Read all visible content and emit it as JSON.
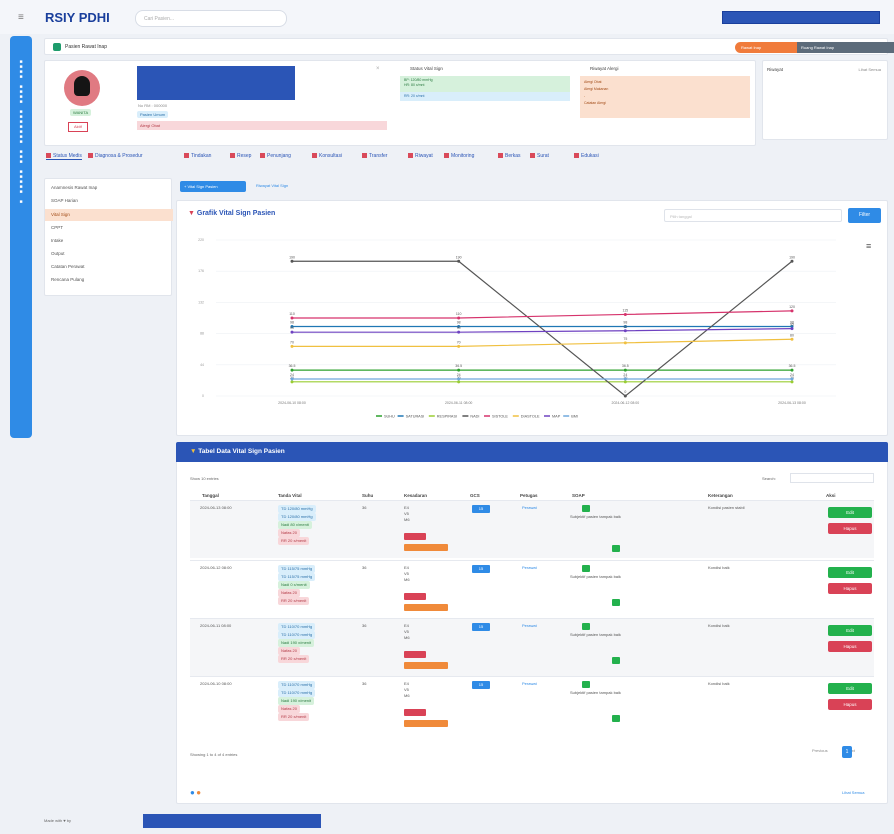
{
  "app": {
    "brand": "RSIY PDHI",
    "search_placeholder": "Cari Pasien..."
  },
  "header": {
    "title": "Pasien Rawat Inap",
    "status_pill": "Rawat Inap",
    "status_detail": "Ruang Rawat Inap"
  },
  "patient": {
    "gender_badge": "WANITA",
    "status_badge": "Aktif",
    "id_line": "No RM : 000000",
    "tag_blue": "Pasien Umum",
    "tag_red": "Alergi Obat"
  },
  "vital_card": {
    "title": "Status Vital Sign",
    "lines": [
      "BP: 120/80 mmHg",
      "HR: 80 x/mnt",
      "RR: 20 x/mnt"
    ]
  },
  "allergy_card": {
    "title": "Riwayat Alergi",
    "lines": [
      "Alergi Obat",
      "Alergi Makanan",
      "-",
      "Catatan Alergi"
    ]
  },
  "gap_card": {
    "title": "Riwayat",
    "link": "Lihat Semua"
  },
  "tabs": [
    "Status Medis",
    "Diagnosa & Prosedur",
    "Tindakan",
    "Resep",
    "Penunjang",
    "Konsultasi",
    "Transfer",
    "Riwayat",
    "Monitoring",
    "Berkas",
    "Surat",
    "Edukasi"
  ],
  "side_menu": [
    "Anamnesis Rawat Inap",
    "SOAP Harian",
    "Vital Sign",
    "CPPT",
    "Intake",
    "Output",
    "Catatan Perawat",
    "Rencana Pulang"
  ],
  "side_menu_active": 2,
  "buttons": {
    "add_vital": "+ Vital Sign Pasien",
    "export": "Riwayat Vital Sign",
    "filter": "Filter"
  },
  "chart": {
    "title": "Grafik Vital Sign Pasien",
    "filter_placeholder": "Pilih tanggal"
  },
  "chart_data": {
    "type": "line",
    "x": [
      "2024-06-10 08:00",
      "2024-06-11 08:00",
      "2024-06-12 08:00",
      "2024-06-13 08:00"
    ],
    "ylim": [
      0,
      220
    ],
    "series": [
      {
        "name": "SUHU",
        "color": "#2ca02c",
        "values": [
          36.5,
          36.5,
          36.5,
          36.5
        ]
      },
      {
        "name": "SATURASI",
        "color": "#1f77b4",
        "values": [
          98,
          98,
          98,
          98
        ]
      },
      {
        "name": "RESPIRASI",
        "color": "#9acd32",
        "values": [
          20,
          20,
          20,
          20
        ]
      },
      {
        "name": "NADI",
        "color": "#555555",
        "values": [
          190,
          190,
          0,
          190
        ]
      },
      {
        "name": "SISTOLE",
        "color": "#d6336c",
        "values": [
          110,
          110,
          115,
          120
        ]
      },
      {
        "name": "DIASTOLE",
        "color": "#f0c040",
        "values": [
          70,
          70,
          75,
          80
        ]
      },
      {
        "name": "MAP",
        "color": "#6f42c1",
        "values": [
          90,
          90,
          92,
          95
        ]
      },
      {
        "name": "BMI",
        "color": "#6fa8dc",
        "values": [
          24,
          24,
          24,
          24
        ]
      }
    ]
  },
  "table": {
    "title": "Tabel Data Vital Sign Pasien",
    "show_label": "Show 10 entries",
    "search_label": "Search:",
    "headers": [
      "Tanggal",
      "Tanda Vital",
      "Suhu",
      "Kesadaran",
      "GCS",
      "Petugas",
      "SOAP",
      "Keterangan",
      "Aksi"
    ],
    "rows": [
      {
        "date": "2024-06-13 08:00",
        "vital": [
          "TD 120/80 mmHg",
          "TD 120/80 mmHg",
          "Nadi 80 x/menit",
          "Nafas 20",
          "RR 20 x/menit"
        ],
        "suhu": "36",
        "kes": [
          "E4",
          "V5",
          "M6"
        ],
        "gcs": "15",
        "petugas": "Perawat",
        "soap": "Subjektif pasien tampak baik",
        "ket": "Kondisi pasien stabil"
      },
      {
        "date": "2024-06-12 08:00",
        "vital": [
          "TD 115/75 mmHg",
          "TD 115/75 mmHg",
          "Nadi 0 x/menit",
          "Nafas 20",
          "RR 20 x/menit"
        ],
        "suhu": "36",
        "kes": [
          "E4",
          "V5",
          "M6"
        ],
        "gcs": "15",
        "petugas": "Perawat",
        "soap": "Subjektif pasien tampak baik",
        "ket": "Kondisi baik"
      },
      {
        "date": "2024-06-11 08:00",
        "vital": [
          "TD 110/70 mmHg",
          "TD 110/70 mmHg",
          "Nadi 190 x/menit",
          "Nafas 20",
          "RR 20 x/menit"
        ],
        "suhu": "36",
        "kes": [
          "E4",
          "V5",
          "M6"
        ],
        "gcs": "15",
        "petugas": "Perawat",
        "soap": "Subjektif pasien tampak baik",
        "ket": "Kondisi baik"
      },
      {
        "date": "2024-06-10 08:00",
        "vital": [
          "TD 110/70 mmHg",
          "TD 110/70 mmHg",
          "Nadi 190 x/menit",
          "Nafas 20",
          "RR 20 x/menit"
        ],
        "suhu": "36",
        "kes": [
          "E4",
          "V5",
          "M6"
        ],
        "gcs": "15",
        "petugas": "Perawat",
        "soap": "Subjektif pasien tampak baik",
        "ket": "Kondisi baik"
      }
    ],
    "edit_label": "Edit",
    "delete_label": "Hapus",
    "info": "Showing 1 to 4 of 4 entries",
    "prev": "Previous",
    "next": "Next",
    "page": "1"
  },
  "footer": {
    "text": "Made with ♥ by",
    "link": "Lihat Semua"
  }
}
